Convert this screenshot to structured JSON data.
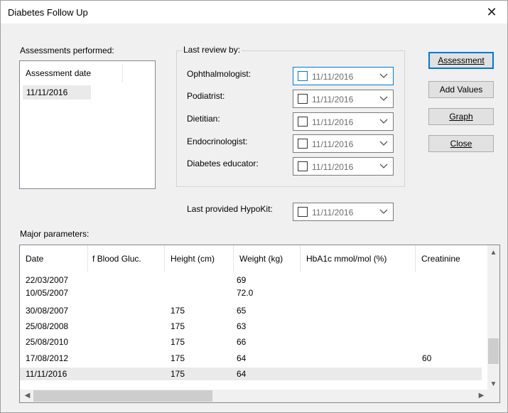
{
  "window": {
    "title": "Diabetes Follow Up",
    "close_symbol": "✕"
  },
  "assessments": {
    "label": "Assessments performed:",
    "header": "Assessment date",
    "items": [
      "11/11/2016"
    ]
  },
  "review": {
    "group_label": "Last review by:",
    "rows": [
      {
        "label": "Ophthalmologist:",
        "date": "11/11/2016"
      },
      {
        "label": "Podiatrist:",
        "date": "11/11/2016"
      },
      {
        "label": "Dietitian:",
        "date": "11/11/2016"
      },
      {
        "label": "Endocrinologist:",
        "date": "11/11/2016"
      },
      {
        "label": "Diabetes educator:",
        "date": "11/11/2016"
      }
    ],
    "hypokit_label": "Last provided HypoKit:",
    "hypokit_date": "11/11/2016"
  },
  "buttons": {
    "assessment": "Assessment",
    "add_values": "Add Values",
    "graph": "Graph",
    "close": "Close"
  },
  "params": {
    "label": "Major parameters:",
    "columns": [
      "Date",
      "f Blood Gluc.",
      "Height (cm)",
      "Weight (kg)",
      "HbA1c mmol/mol (%)",
      "Creatinine"
    ],
    "rows": [
      [
        "22/03/2007",
        "",
        "",
        "69",
        "",
        ""
      ],
      [
        "10/05/2007",
        "",
        "",
        "72.0",
        "",
        ""
      ],
      [
        "30/08/2007",
        "",
        "175",
        "65",
        "",
        ""
      ],
      [
        "25/08/2008",
        "",
        "175",
        "63",
        "",
        ""
      ],
      [
        "25/08/2010",
        "",
        "175",
        "66",
        "",
        ""
      ],
      [
        "17/08/2012",
        "",
        "175",
        "64",
        "",
        "60"
      ],
      [
        "11/11/2016",
        "",
        "175",
        "64",
        "",
        ""
      ]
    ],
    "selected_row": 6,
    "vertical_scroll_fraction": 0.85,
    "horizontal_scroll_fraction": 0.0
  }
}
